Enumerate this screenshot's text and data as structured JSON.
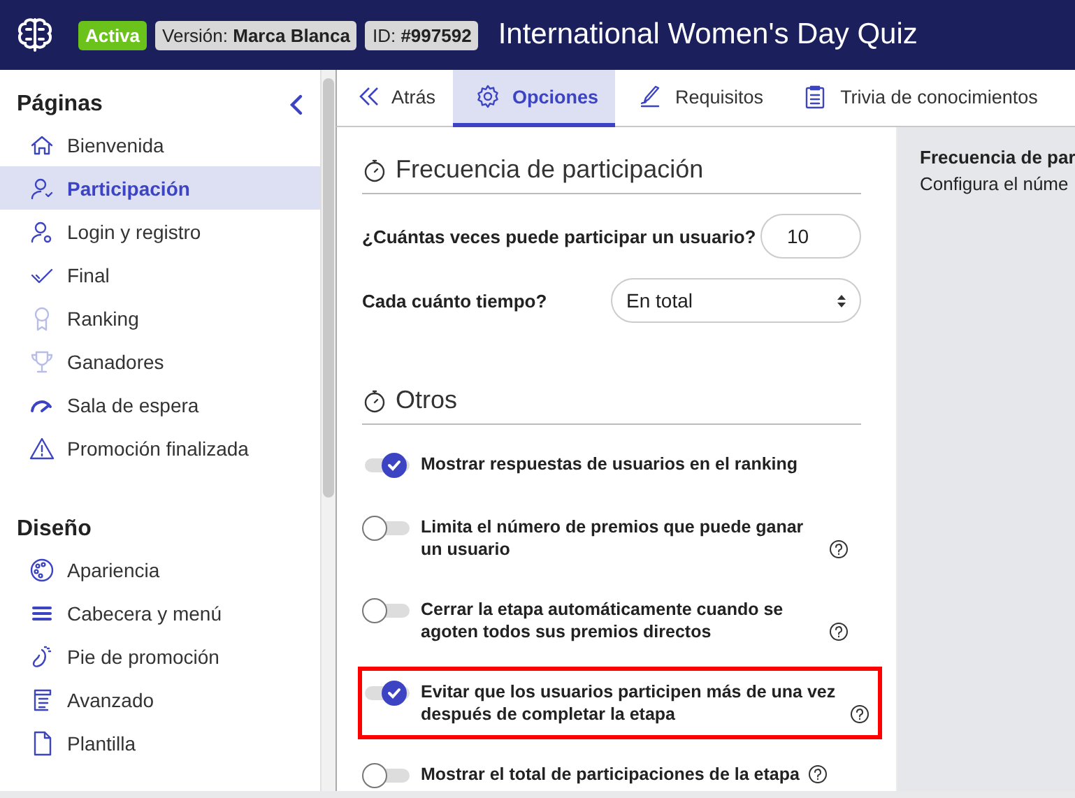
{
  "header": {
    "badges": [
      {
        "kind": "status",
        "text": "Activa"
      },
      {
        "kind": "info",
        "text": "Versión: **Marca Blanca**"
      },
      {
        "kind": "info",
        "text": "ID: **#997592**"
      }
    ],
    "title": "International Women's Day Quiz"
  },
  "sidebar": {
    "sections": [
      {
        "title": "Páginas",
        "items": [
          {
            "label": "Bienvenida",
            "selected": false
          },
          {
            "label": "Participación",
            "selected": true
          },
          {
            "label": "Login y registro",
            "selected": false
          },
          {
            "label": "Final",
            "selected": false
          },
          {
            "label": "Ranking",
            "selected": false
          },
          {
            "label": "Ganadores",
            "selected": false
          },
          {
            "label": "Sala de espera",
            "selected": false
          },
          {
            "label": "Promoción finalizada",
            "selected": false
          }
        ]
      },
      {
        "title": "Diseño",
        "items": [
          {
            "label": "Apariencia",
            "selected": false
          },
          {
            "label": "Cabecera y menú",
            "selected": false
          },
          {
            "label": "Pie de promoción",
            "selected": false
          },
          {
            "label": "Avanzado",
            "selected": false
          },
          {
            "label": "Plantilla",
            "selected": false
          }
        ]
      }
    ]
  },
  "tabs": [
    {
      "label": "Atrás",
      "selected": false
    },
    {
      "label": "Opciones",
      "selected": true
    },
    {
      "label": "Requisitos",
      "selected": false
    },
    {
      "label": "Trivia de conocimientos",
      "selected": false
    }
  ],
  "sections": [
    {
      "title": "Frecuencia de participación",
      "fields": [
        {
          "kind": "number",
          "label": "¿Cuántas veces puede participar un usuario?",
          "value": "10"
        },
        {
          "kind": "select",
          "label": "Cada cuánto tiempo?",
          "value": "En total"
        }
      ]
    },
    {
      "title": "Otros",
      "options": [
        {
          "label": "Mostrar respuestas de usuarios en el ranking",
          "on": true,
          "help": false,
          "highlighted": false
        },
        {
          "label": "Limita el número de premios que puede ganar un usuario",
          "on": false,
          "help": true,
          "highlighted": false
        },
        {
          "label": "Cerrar la etapa automáticamente cuando se agoten todos sus premios directos",
          "on": false,
          "help": true,
          "highlighted": false
        },
        {
          "label": "Evitar que los usuarios participen más de una vez después de completar la etapa",
          "on": true,
          "help": true,
          "highlighted": true
        },
        {
          "label": "Mostrar el total de participaciones de la etapa",
          "on": false,
          "help": true,
          "highlighted": false
        }
      ]
    }
  ],
  "info_panel": {
    "title": "Frecuencia de par",
    "text": "Configura el núme"
  }
}
